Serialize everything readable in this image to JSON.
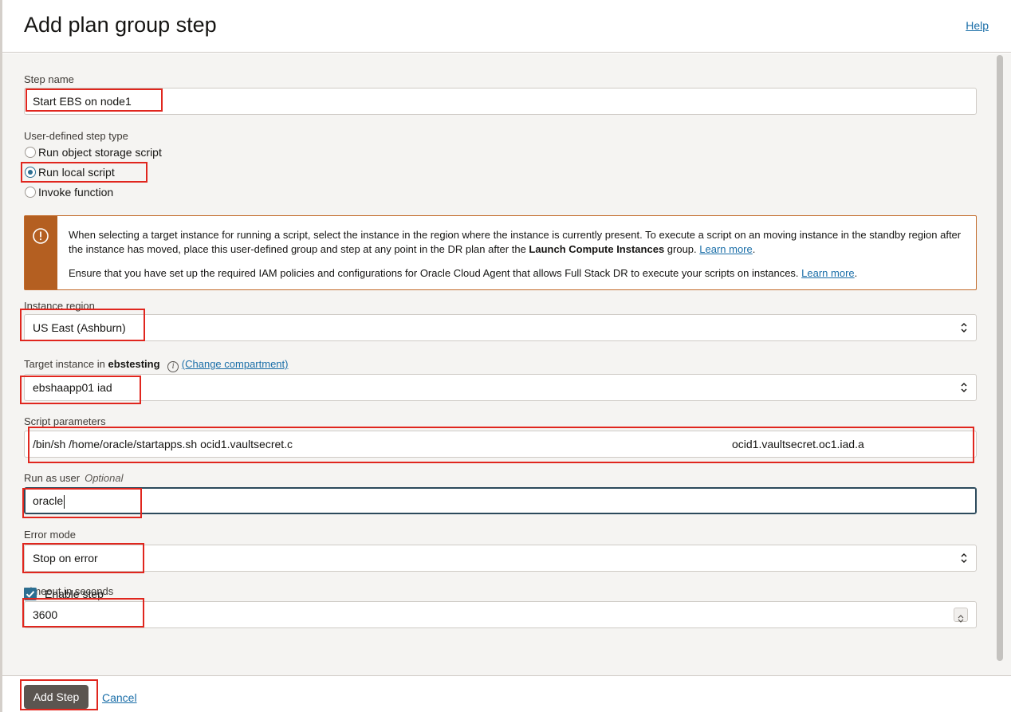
{
  "dialog": {
    "title": "Add plan group step",
    "help_label": "Help"
  },
  "step_name": {
    "label": "Step name",
    "value": "Start EBS on node1"
  },
  "step_type": {
    "label": "User-defined step type",
    "options": [
      {
        "label": "Run object storage script",
        "checked": false
      },
      {
        "label": "Run local script",
        "checked": true
      },
      {
        "label": "Invoke function",
        "checked": false
      }
    ]
  },
  "notice": {
    "p1_text": "When selecting a target instance for running a script, select the instance in the region where the instance is currently present. To execute a script on an moving instance in the standby region after the instance has moved, place this user-defined group and step at any point in the DR plan after the ",
    "p1_bold": "Launch Compute Instances",
    "p1_after": " group. ",
    "p1_link": "Learn more",
    "p1_end": ".",
    "p2_text": "Ensure that you have set up the required IAM policies and configurations for Oracle Cloud Agent that allows Full Stack DR to execute your scripts on instances. ",
    "p2_link": "Learn more",
    "p2_end": "."
  },
  "instance_region": {
    "label": "Instance region",
    "value": "US East (Ashburn)"
  },
  "target_instance": {
    "label_prefix": "Target instance in",
    "compartment": "ebstesting",
    "change_label": "(Change compartment)",
    "value": "ebshaapp01 iad"
  },
  "script_parameters": {
    "label": "Script parameters",
    "value_start": "/bin/sh /home/oracle/startapps.sh ocid1.vaultsecret.c",
    "value_end": "ocid1.vaultsecret.oc1.iad.a"
  },
  "run_as_user": {
    "label": "Run as user",
    "optional": "Optional",
    "value": "oracle"
  },
  "error_mode": {
    "label": "Error mode",
    "value": "Stop on error"
  },
  "timeout": {
    "label": "Timeout in seconds",
    "value": "3600"
  },
  "enable_step": {
    "label": "Enable step",
    "checked": true
  },
  "footer": {
    "add_label": "Add Step",
    "cancel_label": "Cancel"
  },
  "colors": {
    "accent": "#2c6e91",
    "warning": "#b45f21",
    "highlight": "#e0261e",
    "primary_button": "#5b5550"
  }
}
